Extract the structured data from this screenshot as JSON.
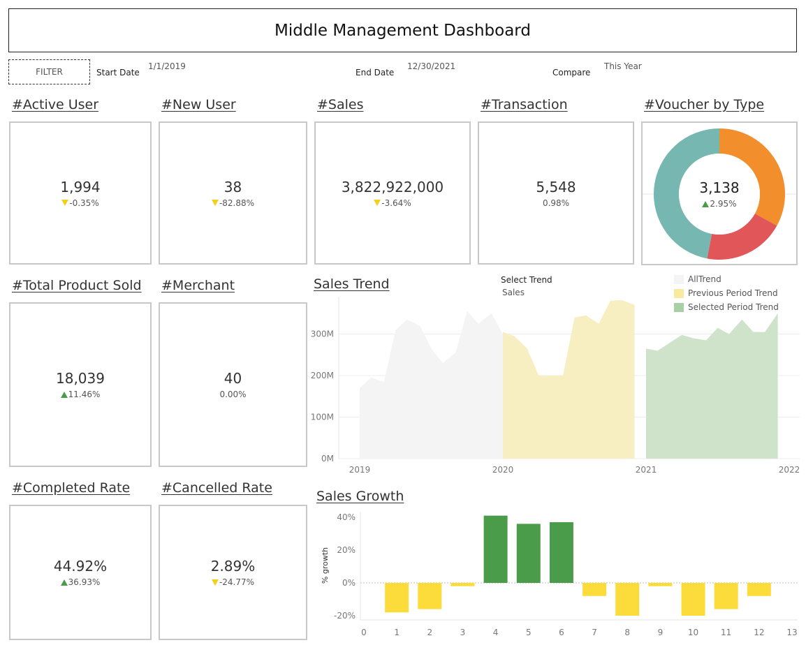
{
  "header": {
    "title": "Middle Management Dashboard"
  },
  "filters": {
    "filter_label": "FILTER",
    "start_date_label": "Start Date",
    "start_date_value": "1/1/2019",
    "end_date_label": "End Date",
    "end_date_value": "12/30/2021",
    "compare_label": "Compare",
    "compare_value": "This Year"
  },
  "kpis": {
    "active_user": {
      "title": "#Active User",
      "value": "1,994",
      "delta": "-0.35%",
      "direction": "down"
    },
    "new_user": {
      "title": "#New User",
      "value": "38",
      "delta": "-82.88%",
      "direction": "down"
    },
    "sales": {
      "title": "#Sales",
      "value": "3,822,922,000",
      "delta": "-3.64%",
      "direction": "down"
    },
    "transaction": {
      "title": "#Transaction",
      "value": "5,548",
      "delta": "0.98%",
      "direction": "none"
    },
    "total_product_sold": {
      "title": "#Total Product Sold",
      "value": "18,039",
      "delta": "11.46%",
      "direction": "up"
    },
    "merchant": {
      "title": "#Merchant",
      "value": "40",
      "delta": "0.00%",
      "direction": "none"
    },
    "completed_rate": {
      "title": "#Completed Rate",
      "value": "44.92%",
      "delta": "36.93%",
      "direction": "up"
    },
    "cancelled_rate": {
      "title": "#Cancelled Rate",
      "value": "2.89%",
      "delta": "-24.77%",
      "direction": "down"
    }
  },
  "voucher": {
    "title": "#Voucher by Type",
    "value": "3,138",
    "delta": "2.95%",
    "direction": "up"
  },
  "sales_trend": {
    "title": "Sales Trend",
    "select_label": "Select Trend",
    "select_value": "Sales",
    "legend": [
      "AllTrend",
      "Previous Period Trend",
      "Selected Period Trend"
    ]
  },
  "sales_growth": {
    "title": "Sales Growth",
    "ylabel": "% growth"
  },
  "colors": {
    "down": "#f2cf1d",
    "up": "#4a9c4a",
    "donut": [
      "#f28e2b",
      "#e15759",
      "#76b7b2"
    ],
    "all_trend": "#f4f4f4",
    "previous": "#f7efc2",
    "selected": "#cfe3cb",
    "growth_pos": "#4a9c4a",
    "growth_neg": "#fcdc3b"
  },
  "chart_data": [
    {
      "type": "pie",
      "title": "#Voucher by Type",
      "values": [
        0.33,
        0.2,
        0.47
      ],
      "note_center": "3,138"
    },
    {
      "type": "area",
      "title": "Sales Trend",
      "x_ticks": [
        "2019",
        "2020",
        "2021",
        "2022"
      ],
      "y_ticks": [
        "0M",
        "100M",
        "200M",
        "300M"
      ],
      "ylim": [
        0,
        390
      ],
      "series": [
        {
          "name": "AllTrend",
          "x": [
            2019.0,
            2019.08,
            2019.17,
            2019.25,
            2019.33,
            2019.42,
            2019.5,
            2019.58,
            2019.67,
            2019.75,
            2019.83,
            2019.92,
            2020.0
          ],
          "values": [
            170,
            195,
            185,
            310,
            335,
            320,
            265,
            230,
            255,
            355,
            325,
            350,
            300
          ]
        },
        {
          "name": "Previous Period Trend",
          "x": [
            2020.0,
            2020.08,
            2020.17,
            2020.25,
            2020.33,
            2020.42,
            2020.5,
            2020.58,
            2020.67,
            2020.75,
            2020.83,
            2020.92
          ],
          "values": [
            305,
            295,
            265,
            200,
            200,
            200,
            340,
            345,
            325,
            380,
            382,
            370
          ]
        },
        {
          "name": "Selected Period Trend",
          "x": [
            2021.0,
            2021.08,
            2021.17,
            2021.25,
            2021.33,
            2021.42,
            2021.5,
            2021.58,
            2021.67,
            2021.75,
            2021.83,
            2021.92
          ],
          "values": [
            265,
            260,
            280,
            298,
            290,
            285,
            315,
            300,
            335,
            305,
            305,
            350
          ]
        }
      ]
    },
    {
      "type": "bar",
      "title": "Sales Growth",
      "ylabel": "% growth",
      "categories": [
        1,
        2,
        3,
        4,
        5,
        6,
        7,
        8,
        9,
        10,
        11,
        12
      ],
      "values": [
        -18,
        -16,
        -2,
        41,
        36,
        37,
        -8,
        -20,
        -2,
        -20,
        -16,
        -8
      ],
      "x_ticks": [
        "0",
        "1",
        "2",
        "3",
        "4",
        "5",
        "6",
        "7",
        "8",
        "9",
        "10",
        "11",
        "12",
        "13"
      ],
      "y_ticks": [
        "40%",
        "20%",
        "0%",
        "-20%"
      ],
      "ylim": [
        -22,
        42
      ]
    }
  ]
}
